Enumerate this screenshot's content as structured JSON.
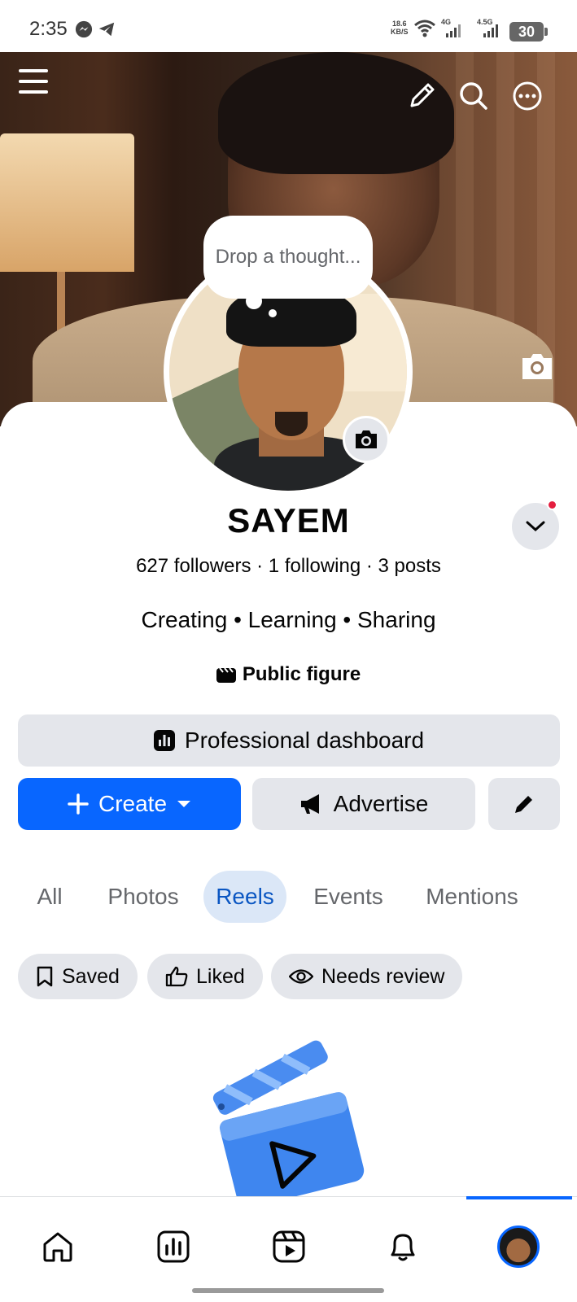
{
  "status_bar": {
    "time": "2:35",
    "net_speed_value": "18.6",
    "net_speed_unit": "KB/S",
    "sim1_label": "4G",
    "sim2_label": "4.5G",
    "battery": "30"
  },
  "cover": {
    "icons": [
      "menu-icon",
      "pencil-icon",
      "search-icon",
      "more-icon",
      "camera-icon"
    ]
  },
  "profile": {
    "thought_placeholder": "Drop a thought...",
    "name": "SAYEM",
    "stats": "627 followers · 1 following · 3 posts",
    "bio": "Creating • Learning • Sharing",
    "category": "Public figure"
  },
  "actions": {
    "dashboard_label": "Professional dashboard",
    "create_label": "Create",
    "advertise_label": "Advertise"
  },
  "tabs": [
    "All",
    "Photos",
    "Reels",
    "Events",
    "Mentions"
  ],
  "active_tab": "Reels",
  "filters": [
    "Saved",
    "Liked",
    "Needs review"
  ],
  "colors": {
    "accent": "#0866ff",
    "button_grey": "#e4e6eb",
    "active_tab_bg": "#dbe7f7",
    "notification_dot": "#e41e3f"
  },
  "bottom_nav": [
    "home-icon",
    "dashboard-icon",
    "reels-icon",
    "bell-icon",
    "profile-avatar"
  ]
}
